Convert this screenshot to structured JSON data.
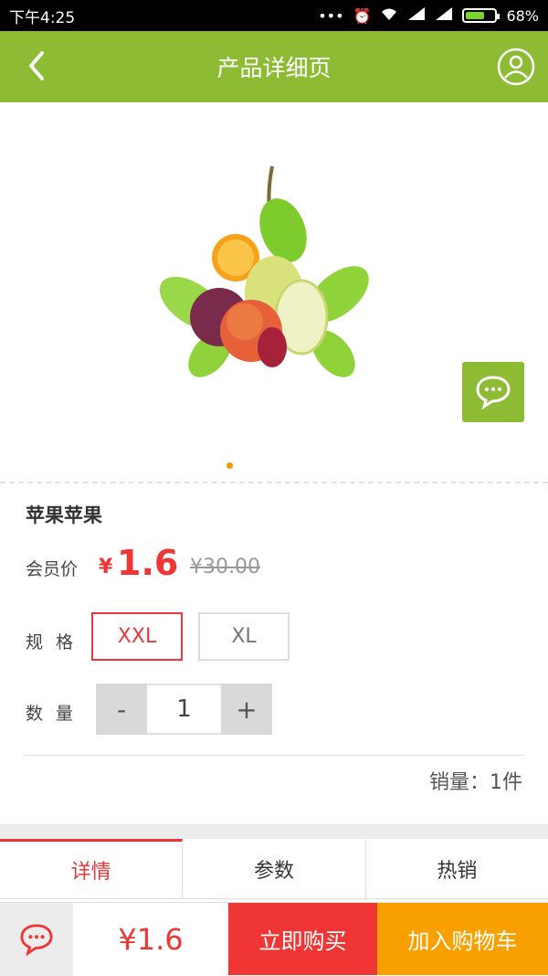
{
  "status_bar": {
    "time": "下午4:25",
    "battery": "68%",
    "battery_level": 0.68
  },
  "header": {
    "title": "产品详细页"
  },
  "product": {
    "name": "苹果苹果",
    "member_price_label": "会员价",
    "currency": "¥",
    "price": "1.6",
    "original_price": "¥30.00"
  },
  "spec": {
    "label": "规格",
    "options": [
      "XXL",
      "XL"
    ],
    "selected": "XXL"
  },
  "quantity": {
    "label": "数量",
    "minus": "-",
    "value": "1",
    "plus": "+"
  },
  "sales": {
    "text": "销量：1件"
  },
  "tabs": [
    {
      "label": "详情"
    },
    {
      "label": "参数"
    },
    {
      "label": "热销"
    }
  ],
  "bottom_bar": {
    "price": "¥1.6",
    "buy_now": "立即购买",
    "add_to_cart": "加入购物车"
  },
  "colors": {
    "brand_green": "#8dbc34",
    "price_red": "#f03535",
    "cart_orange": "#f8a000",
    "carousel_dot": "#f39800"
  },
  "icons": [
    "back-icon",
    "user-icon",
    "chat-icon",
    "signal-icon",
    "wifi-icon",
    "alarm-icon",
    "battery-icon"
  ]
}
